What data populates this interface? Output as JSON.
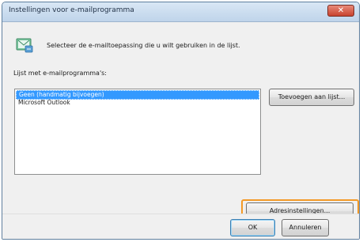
{
  "window": {
    "title": "Instellingen voor e-mailprogramma",
    "close_glyph": "✕"
  },
  "intro": {
    "icon": "email-settings-icon",
    "text": "Selecteer de e-mailtoepassing die u wilt gebruiken in de lijst."
  },
  "list": {
    "label": "Lijst met e-mailprogramma's:",
    "items": [
      {
        "label": "Geen (handmatig bijvoegen)",
        "selected": true
      },
      {
        "label": "Microsoft Outlook",
        "selected": false
      }
    ]
  },
  "buttons": {
    "add_to_list": "Toevoegen aan lijst...",
    "advanced": "Adresinstellingen...",
    "ok": "OK",
    "cancel": "Annuleren"
  },
  "colors": {
    "selection": "#3399ff",
    "highlight": "#f39a27",
    "close": "#c8432f"
  }
}
